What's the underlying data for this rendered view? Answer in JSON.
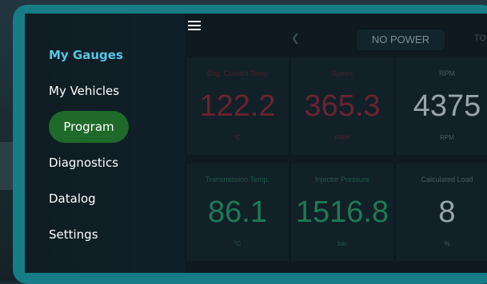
{
  "sidebar": {
    "items": [
      {
        "label": "My Gauges"
      },
      {
        "label": "My Vehicles"
      },
      {
        "label": "Program"
      },
      {
        "label": "Diagnostics"
      },
      {
        "label": "Datalog"
      },
      {
        "label": "Settings"
      }
    ]
  },
  "topbar": {
    "mode_label": "NO POWER",
    "next_mode_label": "TO"
  },
  "gauges": [
    {
      "label": "Eng. Coolant Temp",
      "value": "122.2",
      "unit": "°C"
    },
    {
      "label": "Speed",
      "value": "365.3",
      "unit": "KM/H"
    },
    {
      "label": "RPM",
      "value": "4375",
      "unit": "RPM"
    },
    {
      "label": "Transmission Temp.",
      "value": "86.1",
      "unit": "°C"
    },
    {
      "label": "Injector Pressure",
      "value": "1516.8",
      "unit": "bar"
    },
    {
      "label": "Calculated Load",
      "value": "8",
      "unit": "%"
    }
  ],
  "colors": {
    "bezel": "#167c86",
    "active_menu": "#55c6e6",
    "selected_menu_bg": "#1f6a2a",
    "warning_value": "#6a2331",
    "normal_value": "#1e7a56",
    "neutral_value": "#9aa5a9"
  }
}
